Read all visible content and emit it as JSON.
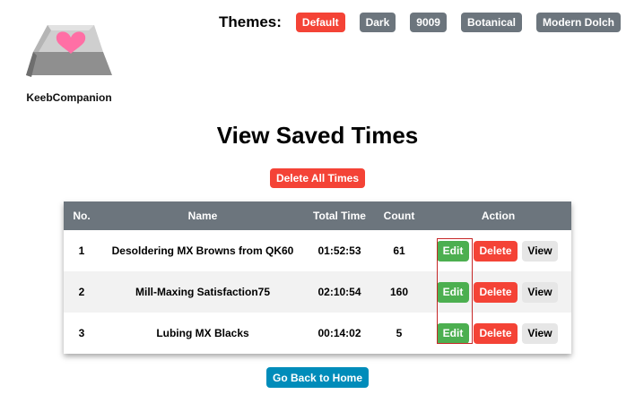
{
  "app": {
    "name": "KeebCompanion"
  },
  "themes": {
    "label": "Themes:",
    "options": [
      {
        "label": "Default",
        "active": true
      },
      {
        "label": "Dark",
        "active": false
      },
      {
        "label": "9009",
        "active": false
      },
      {
        "label": "Botanical",
        "active": false
      },
      {
        "label": "Modern Dolch",
        "active": false
      }
    ]
  },
  "page": {
    "title": "View Saved Times",
    "delete_all_label": "Delete All Times",
    "go_home_label": "Go Back to Home"
  },
  "table": {
    "headers": {
      "no": "No.",
      "name": "Name",
      "total_time": "Total Time",
      "count": "Count",
      "action": "Action"
    },
    "rows": [
      {
        "no": "1",
        "name": "Desoldering MX Browns from QK60",
        "total_time": "01:52:53",
        "count": "61"
      },
      {
        "no": "2",
        "name": "Mill-Maxing Satisfaction75",
        "total_time": "02:10:54",
        "count": "160"
      },
      {
        "no": "3",
        "name": "Lubing MX Blacks",
        "total_time": "00:14:02",
        "count": "5"
      }
    ],
    "actions": {
      "edit": "Edit",
      "delete": "Delete",
      "view": "View"
    }
  },
  "colors": {
    "accent_red": "#f44336",
    "edit_green": "#4caf50",
    "header_grey": "#6c757d",
    "home_blue": "#008cba",
    "logo_heart": "#ff6fa5"
  },
  "icons": {
    "logo": "keycap-heart-icon"
  }
}
